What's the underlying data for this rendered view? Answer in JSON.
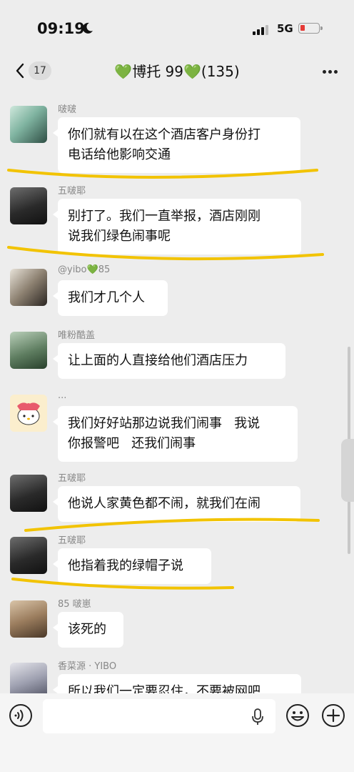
{
  "status_bar": {
    "time": "09:19",
    "network": "5G"
  },
  "header": {
    "unread_count": "17",
    "group_title": "💚博托 99💚(135)"
  },
  "messages": [
    {
      "name": "啵啵",
      "lines": [
        "你们就有以在这个酒店客户身份打",
        "电话给他影响交通"
      ]
    },
    {
      "name": "五啵耶",
      "lines": [
        "别打了。我们一直举报，酒店刚刚",
        "说我们绿色闹事呢"
      ]
    },
    {
      "name": "@yibo💚85",
      "lines": [
        "我们才几个人"
      ]
    },
    {
      "name": "唯粉酷盖",
      "lines": [
        "让上面的人直接给他们酒店压力"
      ]
    },
    {
      "name": "...",
      "lines": [
        "我们好好站那边说我们闹事   我说",
        "你报警吧   还我们闹事"
      ]
    },
    {
      "name": "五啵耶",
      "lines": [
        "他说人家黄色都不闹，就我们在闹"
      ]
    },
    {
      "name": "五啵耶",
      "lines": [
        "他指着我的绿帽子说"
      ]
    },
    {
      "name": "85 啵崽",
      "lines": [
        "该死的"
      ]
    },
    {
      "name": "香菜源 · YIBO",
      "lines": [
        "所以我们一定要忍住，不要被网吧"
      ]
    }
  ],
  "input": {
    "value": ""
  },
  "colors": {
    "highlight": "#f2c300",
    "battery_low": "#e53935",
    "heart": "#39c03a"
  }
}
